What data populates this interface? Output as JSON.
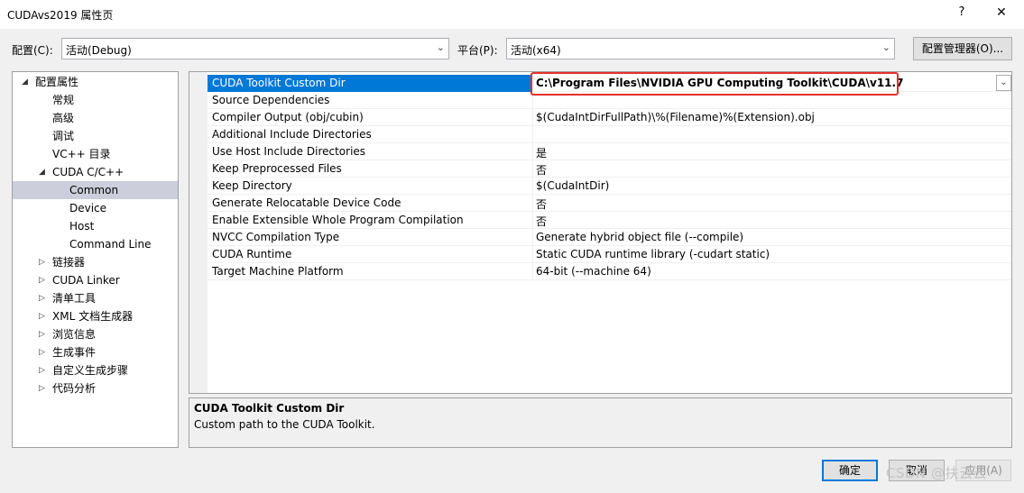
{
  "window": {
    "title": "CUDAvs2019 属性页",
    "help_glyph": "?",
    "close_glyph": "✕"
  },
  "toolbar": {
    "config_label": "配置(C):",
    "config_value": "活动(Debug)",
    "platform_label": "平台(P):",
    "platform_value": "活动(x64)",
    "config_manager_label": "配置管理器(O)..."
  },
  "tree": {
    "items": [
      {
        "label": "配置属性",
        "level": 0,
        "arrow": "expanded"
      },
      {
        "label": "常规",
        "level": 1
      },
      {
        "label": "高级",
        "level": 1
      },
      {
        "label": "调试",
        "level": 1
      },
      {
        "label": "VC++ 目录",
        "level": 1
      },
      {
        "label": "CUDA C/C++",
        "level": 1,
        "arrow": "expanded"
      },
      {
        "label": "Common",
        "level": 2,
        "selected": true
      },
      {
        "label": "Device",
        "level": 2
      },
      {
        "label": "Host",
        "level": 2
      },
      {
        "label": "Command Line",
        "level": 2
      },
      {
        "label": "链接器",
        "level": 1,
        "arrow": "collapsed"
      },
      {
        "label": "CUDA Linker",
        "level": 1,
        "arrow": "collapsed"
      },
      {
        "label": "清单工具",
        "level": 1,
        "arrow": "collapsed"
      },
      {
        "label": "XML 文档生成器",
        "level": 1,
        "arrow": "collapsed"
      },
      {
        "label": "浏览信息",
        "level": 1,
        "arrow": "collapsed"
      },
      {
        "label": "生成事件",
        "level": 1,
        "arrow": "collapsed"
      },
      {
        "label": "自定义生成步骤",
        "level": 1,
        "arrow": "collapsed"
      },
      {
        "label": "代码分析",
        "level": 1,
        "arrow": "collapsed"
      }
    ]
  },
  "properties": {
    "rows": [
      {
        "name": "CUDA Toolkit Custom Dir",
        "value": "C:\\Program Files\\NVIDIA GPU Computing Toolkit\\CUDA\\v11.7",
        "selected": true
      },
      {
        "name": "Source Dependencies",
        "value": ""
      },
      {
        "name": "Compiler Output (obj/cubin)",
        "value": "$(CudaIntDirFullPath)\\%(Filename)%(Extension).obj"
      },
      {
        "name": "Additional Include Directories",
        "value": ""
      },
      {
        "name": "Use Host Include Directories",
        "value": "是"
      },
      {
        "name": "Keep Preprocessed Files",
        "value": "否"
      },
      {
        "name": "Keep Directory",
        "value": "$(CudaIntDir)"
      },
      {
        "name": "Generate Relocatable Device Code",
        "value": "否"
      },
      {
        "name": "Enable Extensible Whole Program Compilation",
        "value": "否"
      },
      {
        "name": "NVCC Compilation Type",
        "value": "Generate hybrid object file (--compile)"
      },
      {
        "name": "CUDA Runtime",
        "value": "Static CUDA runtime library (-cudart static)"
      },
      {
        "name": "Target Machine Platform",
        "value": "64-bit (--machine 64)"
      }
    ]
  },
  "description": {
    "title": "CUDA Toolkit Custom Dir",
    "text": "Custom path to the CUDA Toolkit."
  },
  "buttons": {
    "ok": "确定",
    "cancel": "取消",
    "apply": "应用(A)"
  },
  "watermark": "CSDN @扶云云",
  "colors": {
    "selection": "#0078d7",
    "tree_selection": "#cccedb",
    "highlight_box": "#e5302d"
  }
}
